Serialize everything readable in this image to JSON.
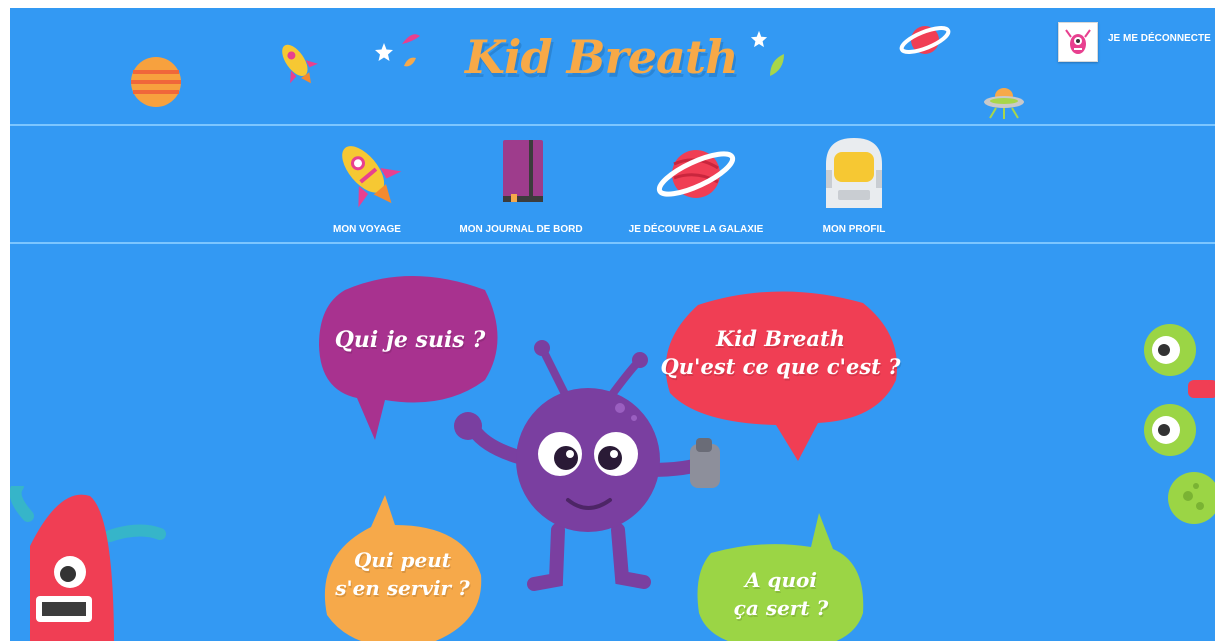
{
  "app": {
    "brand": "Kid Breath",
    "logout_label": "JE ME DÉCONNECTE",
    "colors": {
      "background": "#3399f3",
      "brand": "#f7a947",
      "bubble_purple": "#a8328f",
      "bubble_red": "#f03e54",
      "bubble_orange": "#f6a94a",
      "bubble_green": "#9bd545"
    }
  },
  "nav": {
    "items": [
      {
        "label": "MON VOYAGE",
        "icon": "rocket-icon"
      },
      {
        "label": "MON JOURNAL DE BORD",
        "icon": "logbook-icon"
      },
      {
        "label": "JE DÉCOUVRE LA GALAXIE",
        "icon": "planet-icon"
      },
      {
        "label": "MON PROFIL",
        "icon": "astronaut-helmet-icon"
      }
    ]
  },
  "bubbles": {
    "who": {
      "line1": "Qui je suis ?"
    },
    "what": {
      "line1": "Kid Breath",
      "line2": "Qu'est ce que c'est ?"
    },
    "who_can": {
      "line1": "Qui peut",
      "line2": "s'en servir ?"
    },
    "why": {
      "line1": "A quoi",
      "line2": "ça sert ?"
    }
  }
}
